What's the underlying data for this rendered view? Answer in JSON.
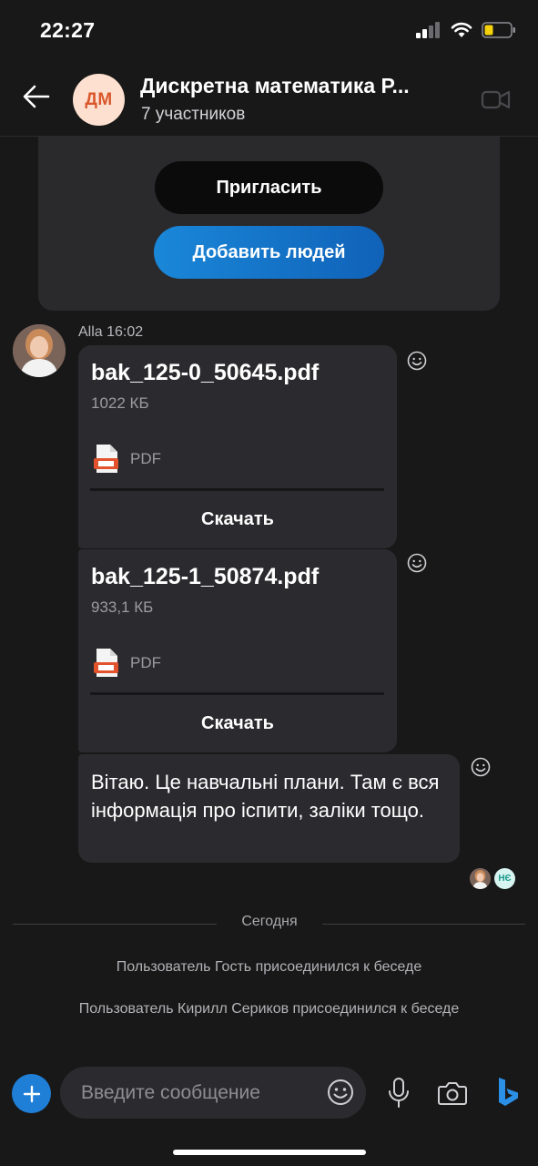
{
  "status_bar": {
    "time": "22:27"
  },
  "header": {
    "avatar_initials": "ДМ",
    "title": "Дискретна математика Р...",
    "subtitle": "7 участников"
  },
  "invite_card": {
    "invite_label": "Пригласить",
    "add_people_label": "Добавить людей"
  },
  "message_group": {
    "sender_meta": "Alla 16:02",
    "files": [
      {
        "name": "bak_125-0_50645.pdf",
        "size": "1022 КБ",
        "type": "PDF",
        "download_label": "Скачать"
      },
      {
        "name": "bak_125-1_50874.pdf",
        "size": "933,1 КБ",
        "type": "PDF",
        "download_label": "Скачать"
      }
    ],
    "text": "Вітаю. Це навчальні плани. Там є вся інформація про іспити, заліки тощо."
  },
  "read_receipts": {
    "initials": "НЄ"
  },
  "day_separator": "Сегодня",
  "system_messages": [
    "Пользователь Гость присоединился к беседе",
    "Пользователь Кирилл Сериков присоединился к беседе"
  ],
  "composer": {
    "placeholder": "Введите сообщение"
  },
  "icons": {
    "back": "arrow-left-icon",
    "video": "video-camera-icon",
    "reaction": "smiley-icon",
    "add": "plus-icon",
    "emoji": "emoji-icon",
    "mic": "microphone-icon",
    "camera": "camera-icon",
    "bing": "bing-icon",
    "pdf": "pdf-file-icon"
  },
  "colors": {
    "background": "#181818",
    "bubble": "#2b2b2f",
    "accent_blue": "#1a87d8",
    "avatar_bg": "#fde0cf",
    "avatar_text": "#d9572b"
  }
}
